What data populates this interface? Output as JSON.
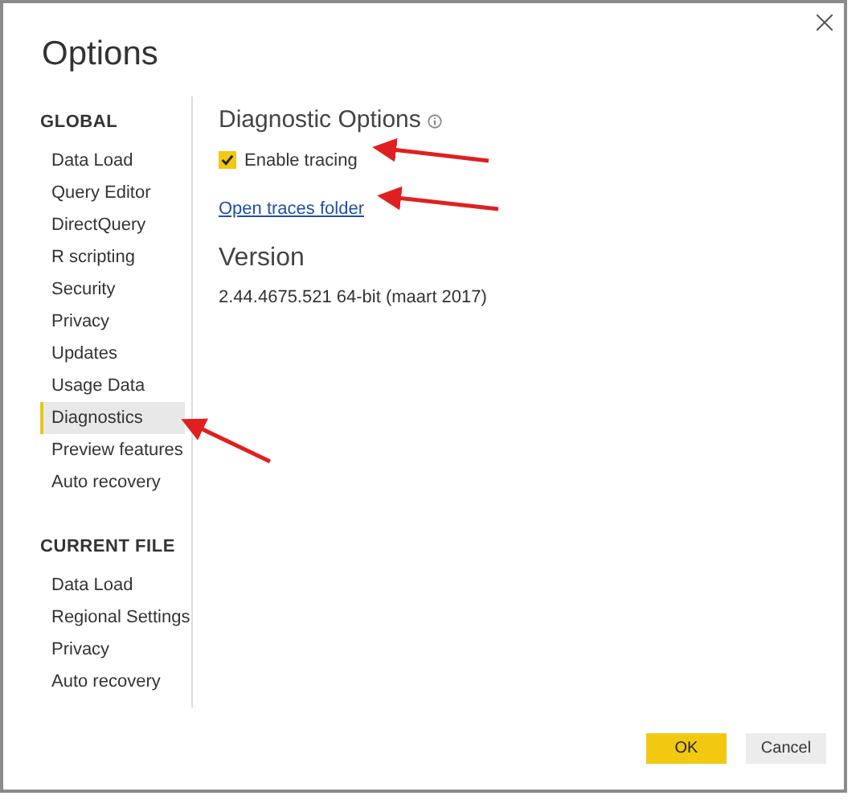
{
  "window": {
    "title": "Options"
  },
  "sidebar": {
    "sections": [
      {
        "heading": "GLOBAL",
        "items": [
          {
            "label": "Data Load",
            "selected": false
          },
          {
            "label": "Query Editor",
            "selected": false
          },
          {
            "label": "DirectQuery",
            "selected": false
          },
          {
            "label": "R scripting",
            "selected": false
          },
          {
            "label": "Security",
            "selected": false
          },
          {
            "label": "Privacy",
            "selected": false
          },
          {
            "label": "Updates",
            "selected": false
          },
          {
            "label": "Usage Data",
            "selected": false
          },
          {
            "label": "Diagnostics",
            "selected": true
          },
          {
            "label": "Preview features",
            "selected": false
          },
          {
            "label": "Auto recovery",
            "selected": false
          }
        ]
      },
      {
        "heading": "CURRENT FILE",
        "items": [
          {
            "label": "Data Load",
            "selected": false
          },
          {
            "label": "Regional Settings",
            "selected": false
          },
          {
            "label": "Privacy",
            "selected": false
          },
          {
            "label": "Auto recovery",
            "selected": false
          }
        ]
      }
    ]
  },
  "content": {
    "heading": "Diagnostic Options",
    "checkbox": {
      "label": "Enable tracing",
      "checked": true
    },
    "link": "Open traces folder",
    "version_heading": "Version",
    "version": "2.44.4675.521 64-bit (maart 2017)"
  },
  "buttons": [
    {
      "label": "OK",
      "kind": "primary"
    },
    {
      "label": "Cancel",
      "kind": "secondary"
    }
  ]
}
